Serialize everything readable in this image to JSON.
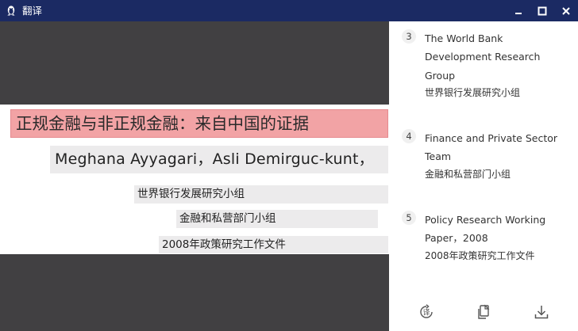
{
  "window": {
    "title": "翻译",
    "controls": [
      "minimize",
      "maximize",
      "close"
    ]
  },
  "preview": {
    "title_cn": "正规金融与非正规金融：来自中国的证据",
    "authors": "Meghana Ayyagari，Asli Demirguc-kunt，",
    "org_cn": "世界银行发展研究小组",
    "dept_cn": "金融和私营部门小组",
    "paper_cn": "2008年政策研究工作文件"
  },
  "translations": [
    {
      "number": "3",
      "source_lines": [
        "The World Bank",
        "Development Research",
        "Group"
      ],
      "translation": "世界银行发展研究小组"
    },
    {
      "number": "4",
      "source_lines": [
        "Finance and Private Sector",
        "Team"
      ],
      "translation": "金融和私营部门小组"
    },
    {
      "number": "5",
      "source_lines": [
        "Policy Research Working",
        "Paper，2008"
      ],
      "translation": "2008年政策研究工作文件"
    }
  ],
  "toolbar": {
    "translate_icon_glyph": "译",
    "icons": [
      "translate-icon",
      "copy-icon",
      "download-icon"
    ]
  },
  "colors": {
    "titlebar": "#1b2a63",
    "preview_bg": "#414042",
    "highlight_title": "#f2a3a5",
    "highlight_other": "#ecebec"
  }
}
